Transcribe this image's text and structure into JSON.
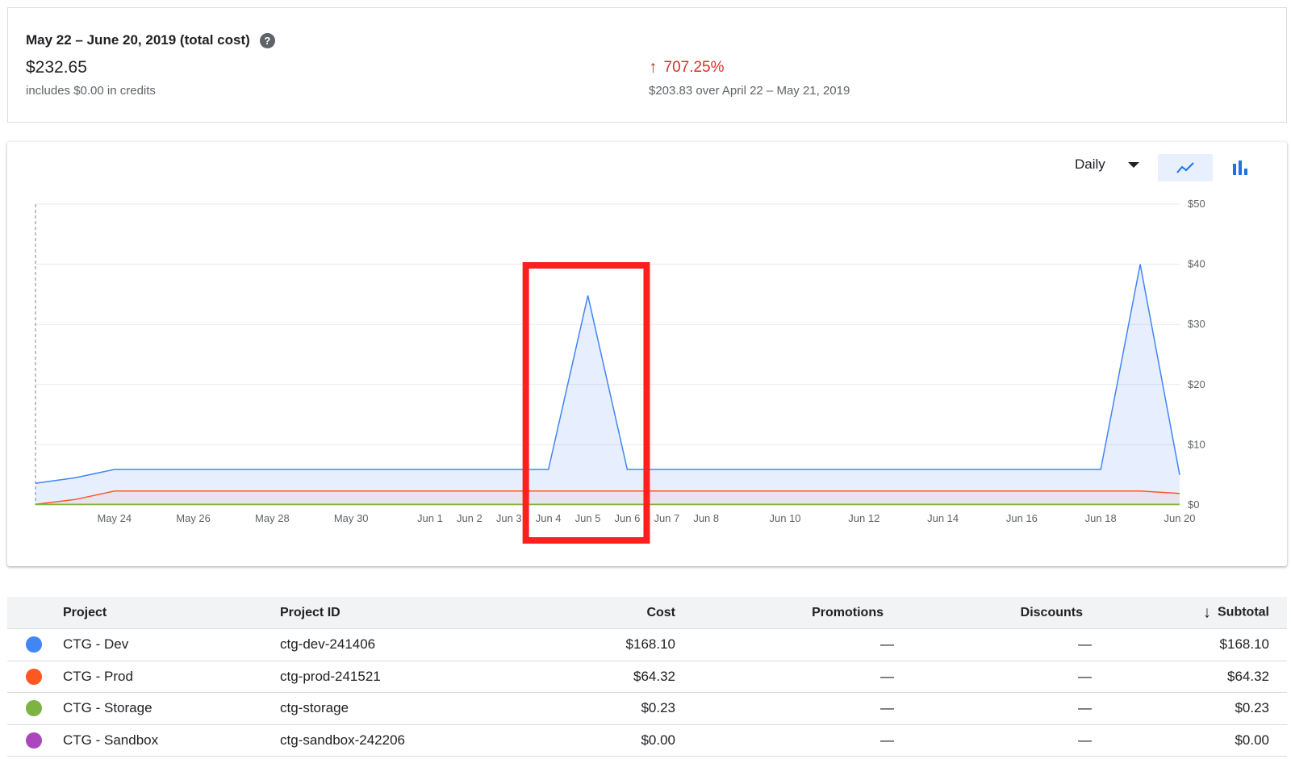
{
  "summary": {
    "title": "May 22 – June 20, 2019 (total cost)",
    "help_icon": "help-circle-icon",
    "total": "$232.65",
    "credits_note": "includes $0.00 in credits",
    "change_pct": "707.25%",
    "change_icon": "arrow-up-icon",
    "prev_period": "$203.83 over April 22 – May 21, 2019"
  },
  "controls": {
    "period": "Daily",
    "line_icon": "line-chart-icon",
    "bar_icon": "bar-chart-icon"
  },
  "chart_data": {
    "type": "area",
    "x": [
      "May 22",
      "May 23",
      "May 24",
      "May 25",
      "May 26",
      "May 27",
      "May 28",
      "May 29",
      "May 30",
      "May 31",
      "Jun 1",
      "Jun 2",
      "Jun 3",
      "Jun 4",
      "Jun 5",
      "Jun 6",
      "Jun 7",
      "Jun 8",
      "Jun 9",
      "Jun 10",
      "Jun 11",
      "Jun 12",
      "Jun 13",
      "Jun 14",
      "Jun 15",
      "Jun 16",
      "Jun 17",
      "Jun 18",
      "Jun 19",
      "Jun 20"
    ],
    "x_tick_labels": [
      "May 24",
      "May 26",
      "May 28",
      "May 30",
      "Jun 1",
      "Jun 2",
      "Jun 3",
      "Jun 4",
      "Jun 5",
      "Jun 6",
      "Jun 7",
      "Jun 8",
      "Jun 10",
      "Jun 12",
      "Jun 14",
      "Jun 16",
      "Jun 18",
      "Jun 20"
    ],
    "y_ticks": [
      "$0",
      "$10",
      "$20",
      "$30",
      "$40",
      "$50"
    ],
    "ylim": [
      0,
      50
    ],
    "series": [
      {
        "color": "#4285f4",
        "values": [
          3.6,
          4.5,
          5.9,
          5.9,
          5.9,
          5.9,
          5.9,
          5.9,
          5.9,
          5.9,
          5.9,
          5.9,
          5.9,
          5.9,
          34.8,
          5.9,
          5.9,
          5.9,
          5.9,
          5.9,
          5.9,
          5.9,
          5.9,
          5.9,
          5.9,
          5.9,
          5.9,
          5.9,
          40.0,
          5.0
        ]
      },
      {
        "color": "#ff5722",
        "values": [
          0.1,
          0.9,
          2.3,
          2.3,
          2.3,
          2.3,
          2.3,
          2.3,
          2.3,
          2.3,
          2.3,
          2.3,
          2.3,
          2.3,
          2.3,
          2.3,
          2.3,
          2.3,
          2.3,
          2.3,
          2.3,
          2.3,
          2.3,
          2.3,
          2.3,
          2.3,
          2.3,
          2.3,
          2.3,
          1.9
        ]
      },
      {
        "color": "#7cb342",
        "values": [
          0.1,
          0.1,
          0.1,
          0.1,
          0.1,
          0.1,
          0.1,
          0.1,
          0.1,
          0.1,
          0.1,
          0.1,
          0.1,
          0.1,
          0.1,
          0.1,
          0.1,
          0.1,
          0.1,
          0.1,
          0.1,
          0.1,
          0.1,
          0.1,
          0.1,
          0.1,
          0.1,
          0.1,
          0.1,
          0.1
        ]
      }
    ],
    "grid": true
  },
  "table": {
    "headers": [
      "Project",
      "Project ID",
      "Cost",
      "Promotions",
      "Discounts",
      "Subtotal"
    ],
    "sort_icon": "arrow-down-icon",
    "rows": [
      {
        "color": "#4285f4",
        "project": "CTG - Dev",
        "id": "ctg-dev-241406",
        "cost": "$168.10",
        "promotions": "—",
        "discounts": "—",
        "subtotal": "$168.10"
      },
      {
        "color": "#ff5722",
        "project": "CTG - Prod",
        "id": "ctg-prod-241521",
        "cost": "$64.32",
        "promotions": "—",
        "discounts": "—",
        "subtotal": "$64.32"
      },
      {
        "color": "#7cb342",
        "project": "CTG - Storage",
        "id": "ctg-storage",
        "cost": "$0.23",
        "promotions": "—",
        "discounts": "—",
        "subtotal": "$0.23"
      },
      {
        "color": "#ab47bc",
        "project": "CTG - Sandbox",
        "id": "ctg-sandbox-242206",
        "cost": "$0.00",
        "promotions": "—",
        "discounts": "—",
        "subtotal": "$0.00"
      }
    ]
  }
}
